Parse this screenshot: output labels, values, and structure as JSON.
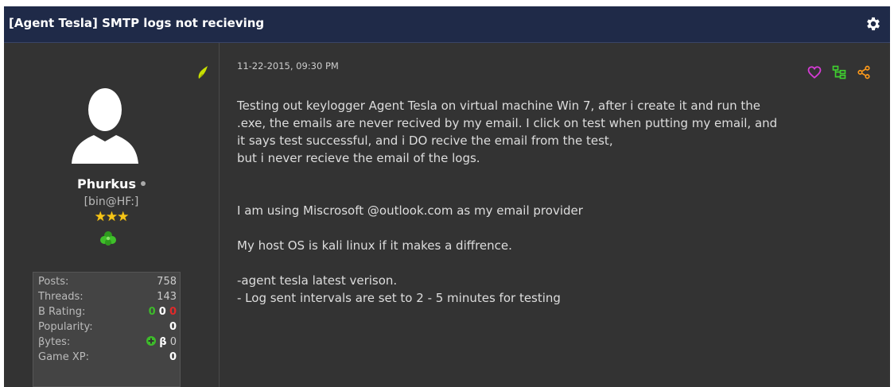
{
  "thread": {
    "title": "[Agent Tesla] SMTP logs not recieving"
  },
  "author": {
    "username": "Phurkus",
    "usertitle": "[bin@HF:]",
    "stars": "★★★",
    "stats": [
      {
        "label": "Posts:",
        "value": "758"
      },
      {
        "label": "Threads:",
        "value": "143"
      },
      {
        "label": "B Rating:",
        "value": "0 0 0",
        "parts": [
          "0",
          "0",
          "0"
        ]
      },
      {
        "label": "Popularity:",
        "value": "0"
      },
      {
        "label": "βytes:",
        "value": "β 0",
        "parts": [
          "β",
          "0"
        ]
      },
      {
        "label": "Game XP:",
        "value": "0"
      }
    ]
  },
  "post": {
    "date": "11-22-2015, 09:30 PM",
    "lines": [
      "Testing out keylogger Agent Tesla on virtual machine Win 7, after i create it and run the",
      ".exe, the emails are never recived by my email. I click on test when putting my email, and",
      "it says test successful, and i DO recive the email from the test,",
      "but i never recieve the email of the logs.",
      "I am using Miscrosoft @outlook.com as my email provider",
      "My host OS is kali linux if it makes a diffrence.",
      "-agent tesla latest verison.",
      "- Log sent intervals are set to 2 - 5 minutes for testing"
    ]
  },
  "icons": {
    "settings": "gear-icon",
    "edit": "pencil-icon",
    "like": "heart-icon",
    "thread": "sitemap-icon",
    "share": "share-icon"
  },
  "colors": {
    "header_bg": "#1f2a48",
    "panel_bg": "#333333",
    "heart": "#d63bd6",
    "sitemap": "#3fcf2f",
    "share": "#ff9a1a",
    "rating_positive": "#3dbb2a",
    "rating_negative": "#e02a2a"
  }
}
